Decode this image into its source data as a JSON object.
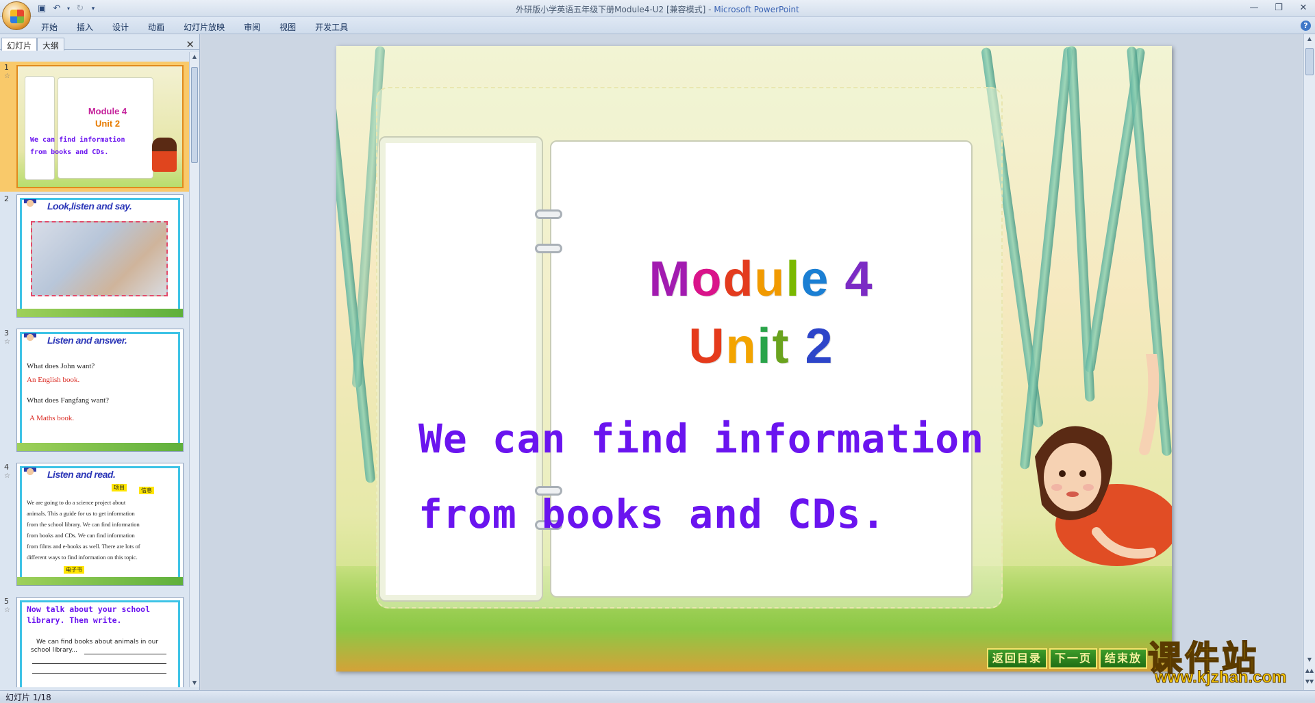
{
  "window": {
    "title": "外研版小学英语五年级下册Module4-U2 [兼容模式]",
    "app_name": "Microsoft PowerPoint",
    "separator": " - "
  },
  "ribbon": {
    "tabs": [
      "开始",
      "插入",
      "设计",
      "动画",
      "幻灯片放映",
      "审阅",
      "视图",
      "开发工具"
    ]
  },
  "left_pane": {
    "tabs": [
      "幻灯片",
      "大纲"
    ],
    "thumbnails": [
      {
        "num": "1",
        "line1": "Module 4",
        "line2": "Unit 2",
        "line3": "We can find information",
        "line4": "from books and CDs."
      },
      {
        "num": "2",
        "heading": "Look,listen and say."
      },
      {
        "num": "3",
        "heading": "Listen and answer.",
        "q1": "What does John want?",
        "a1": "An English book.",
        "q2": "What does Fangfang want?",
        "a2": "A Maths book."
      },
      {
        "num": "4",
        "heading": "Listen and read.",
        "tag1": "项目",
        "tag2": "信息",
        "tag3": "电子书",
        "p1": "We are going to do a science project about",
        "p2": "animals. This a guide for us to get information",
        "p3": "from the school library. We can find information",
        "p4": "from books and CDs. We can find information",
        "p5": "from films and e-books as well. There are lots of",
        "p6": "different ways to find information on this topic."
      },
      {
        "num": "5",
        "heading1": "Now talk about your school",
        "heading2": "library. Then write.",
        "p1": "We can find books about animals in our",
        "p2": "school library..."
      }
    ]
  },
  "slide": {
    "title_line1": [
      "M",
      "o",
      "d",
      "u",
      "l",
      "e",
      " ",
      "4"
    ],
    "title_line2": [
      "U",
      "n",
      "i",
      "t",
      " ",
      "2"
    ],
    "colors_line1": [
      "#a21bb0",
      "#d9138a",
      "#e33b1e",
      "#f19a00",
      "#7ab800",
      "#1b7fd3",
      "#000000",
      "#7b2bc4"
    ],
    "colors_line2": [
      "#e53a1b",
      "#f3a400",
      "#2aa44a",
      "#6aa31e",
      "#000000",
      "#2d45c9"
    ],
    "subtitle_line1": "We can find information",
    "subtitle_line2": "from books and CDs.",
    "nav": [
      "返回目录",
      "下一页",
      "结束放"
    ]
  },
  "watermark": {
    "cn": "课件站",
    "url": "www.kjzhan.com"
  },
  "status": {
    "slide_indicator": "幻灯片 1/18"
  }
}
